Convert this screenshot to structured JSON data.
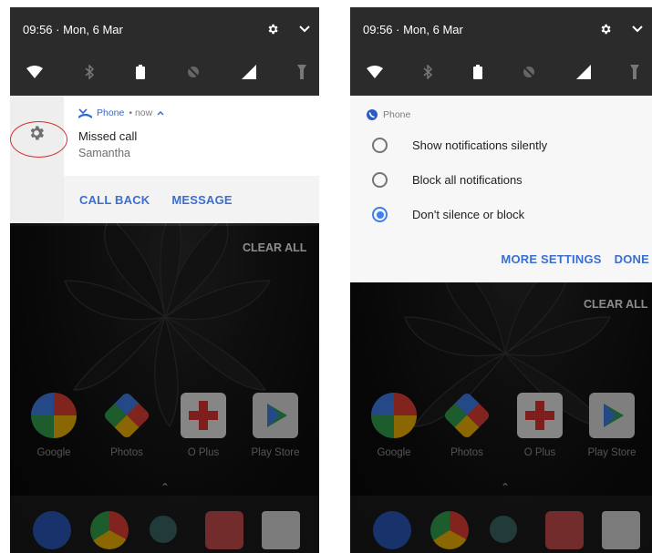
{
  "left_screen": {
    "status": {
      "time_date": "09:56 · Mon, 6 Mar"
    },
    "notification": {
      "app_name": "Phone",
      "time": "• now",
      "title": "Missed call",
      "subtitle": "Samantha",
      "actions": [
        "CALL BACK",
        "MESSAGE"
      ]
    },
    "clear_all": "CLEAR ALL",
    "apps": [
      "Google",
      "Photos",
      "O Plus",
      "Play Store"
    ]
  },
  "right_screen": {
    "status": {
      "time_date": "09:56 · Mon, 6 Mar"
    },
    "panel": {
      "app_name": "Phone",
      "options": [
        {
          "label": "Show notifications silently",
          "selected": false
        },
        {
          "label": "Block all notifications",
          "selected": false
        },
        {
          "label": "Don't silence or block",
          "selected": true
        }
      ],
      "more_settings": "MORE SETTINGS",
      "done": "DONE"
    },
    "clear_all": "CLEAR ALL",
    "apps": [
      "Google",
      "Photos",
      "O Plus",
      "Play Store"
    ]
  },
  "colors": {
    "accent": "#3a6fd1",
    "radio_selected": "#3f7ff0",
    "highlight_ring": "#d32f2f",
    "shade": "#2b2b2b"
  }
}
